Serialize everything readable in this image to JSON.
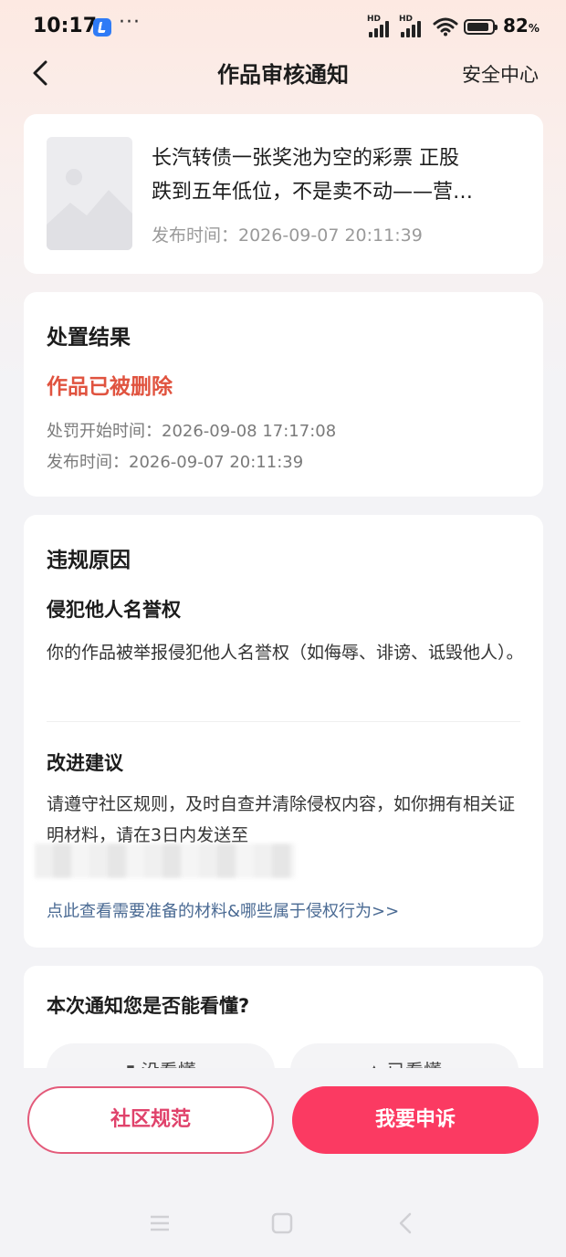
{
  "status_bar": {
    "time": "10:17",
    "dots": "···",
    "battery": "82",
    "battery_unit": "%",
    "signal_1_label": "HD",
    "signal_2_label": "HD"
  },
  "nav": {
    "title": "作品审核通知",
    "right_link": "安全中心"
  },
  "article": {
    "title_line1": "长汽转债一张奖池为空的彩票 正股",
    "title_line2": "跌到五年低位，不是卖不动——营…",
    "publish_time": "发布时间：2026-09-07 20:11:39"
  },
  "result": {
    "section_title": "处置结果",
    "status": "作品已被删除",
    "penalty_start": "处罚开始时间：2026-09-08 17:17:08",
    "publish_time": "发布时间：2026-09-07 20:11:39"
  },
  "reason": {
    "section_title": "违规原因",
    "violation_title": "侵犯他人名誉权",
    "violation_desc": "你的作品被举报侵犯他人名誉权（如侮辱、诽谤、诋毁他人）。",
    "advice_title": "改进建议",
    "advice_desc": "请遵守社区规则，及时自查并清除侵权内容，如你拥有相关证明材料，请在3日内发送至",
    "link": "点此查看需要准备的材料&哪些属于侵权行为>>"
  },
  "feedback": {
    "question": "本次通知您是否能看懂?",
    "option_no": "没看懂",
    "option_yes": "已看懂"
  },
  "actions": {
    "community_rules": "社区规范",
    "appeal": "我要申诉"
  },
  "colors": {
    "accent": "#fb3a62",
    "deleted_status": "#e0533f",
    "link": "#4a6a93"
  }
}
